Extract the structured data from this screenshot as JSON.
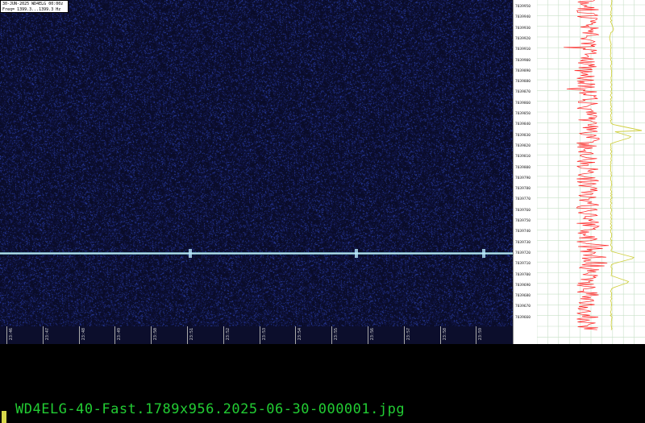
{
  "info": {
    "line1": "30-JUN-2025  WD4ELG  00:00z",
    "line2": "Freq= 1399.3...1399.3 Hz"
  },
  "time_ticks": [
    "23:46",
    "23:47",
    "23:48",
    "23:49",
    "23:50",
    "23:51",
    "23:52",
    "23:53",
    "23:54",
    "23:55",
    "23:56",
    "23:57",
    "23:58",
    "23:59"
  ],
  "freq_labels": [
    "7039950",
    "7039940",
    "7039930",
    "7039920",
    "7039910",
    "7039900",
    "7039890",
    "7039880",
    "7039870",
    "7039860",
    "7039850",
    "7039840",
    "7039830",
    "7039820",
    "7039810",
    "7039800",
    "7039790",
    "7039780",
    "7039770",
    "7039760",
    "7039750",
    "7039740",
    "7039730",
    "7039720",
    "7039710",
    "7039700",
    "7039690",
    "7039680",
    "7039670",
    "7039660"
  ],
  "filename": "WD4ELG-40-Fast.1789x956.2025-06-30-000001.jpg",
  "colors": {
    "waterfall_bg": "#0c0e2c",
    "signal": "#d8f4ff",
    "trace_red": "#ff2020",
    "trace_yellow": "#d0d040",
    "filename_text": "#22cc33"
  }
}
